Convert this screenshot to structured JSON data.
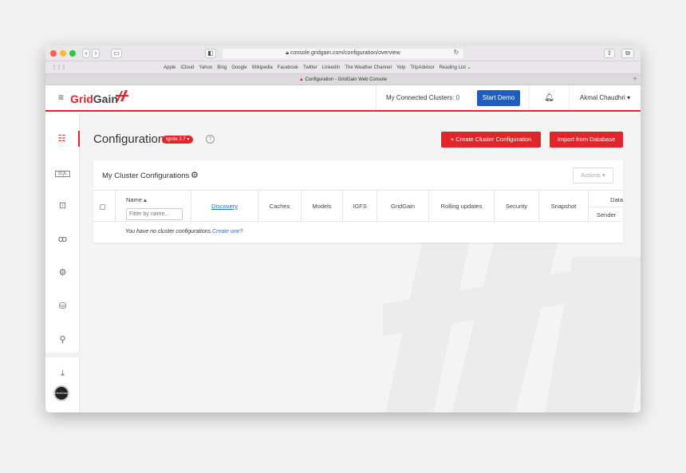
{
  "browser": {
    "url": "console.gridgain.com/configuration/overview",
    "favorites": [
      "Apple",
      "iCloud",
      "Yahoo",
      "Bing",
      "Google",
      "Wikipedia",
      "Facebook",
      "Twitter",
      "LinkedIn",
      "The Weather Channel",
      "Yelp",
      "TripAdvisor",
      "Reading List ⌄"
    ],
    "tab_title": "Configuration - GridGain Web Console"
  },
  "header": {
    "brand_grid": "Grid",
    "brand_gain": "Gain",
    "clusters_label": "My Connected Clusters:",
    "clusters_count": "0",
    "start_demo": "Start Demo",
    "user": "Akmal Chaudhri"
  },
  "sidebar": {
    "items": [
      "configuration-icon",
      "queries-icon",
      "monitoring-icon",
      "clusters-icon",
      "settings-icon",
      "database-icon",
      "search-icon",
      "download-icon"
    ],
    "badge": "GridGain"
  },
  "page": {
    "title": "Configuration",
    "version_badge": "Ignite 2.7",
    "help": "?",
    "create_btn": "Create Cluster Configuration",
    "import_btn": "Import from Database"
  },
  "panel": {
    "title": "My Cluster Configurations",
    "actions": "Actions",
    "columns": {
      "name": "Name",
      "name_placeholder": "Filter by name...",
      "discovery": "Discovery",
      "caches": "Caches",
      "models": "Models",
      "igfs": "IGFS",
      "gridgain": "GridGain",
      "rolling": "Rolling updates",
      "security": "Security",
      "snapshot": "Snapshot",
      "data_top": "Data",
      "data_bottom": "Sender"
    },
    "empty_text": "You have no cluster configurations.",
    "empty_link": "Create one?"
  },
  "colors": {
    "accent": "#e0262b",
    "primary": "#1f5dbd",
    "link": "#2b6fd6"
  }
}
